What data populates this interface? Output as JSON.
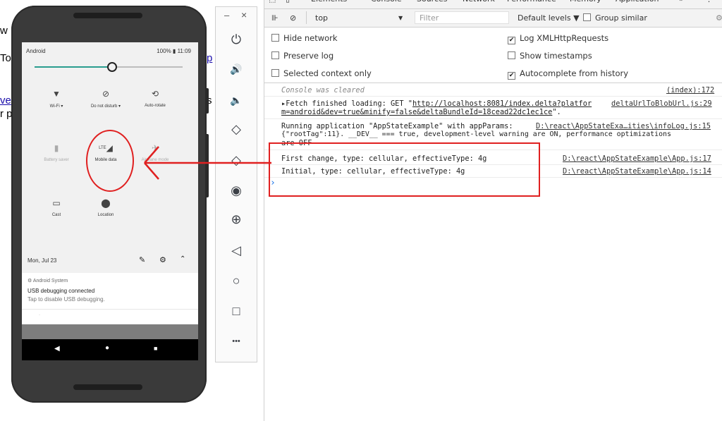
{
  "background_page": {
    "line1": "w",
    "line2": "To",
    "line2_link": "p",
    "line3_link": "ve",
    "line3_tail": "s",
    "line4": "r p"
  },
  "phone": {
    "status_left": "Android",
    "status_right": "100%",
    "status_time": "11:09",
    "tiles": [
      {
        "label": "Wi-Fi ▾",
        "icon": "wifi-off-icon",
        "glyph": "▼",
        "dim": false
      },
      {
        "label": "Do not disturb ▾",
        "icon": "dnd-icon",
        "glyph": "⊘",
        "dim": false
      },
      {
        "label": "Auto-rotate",
        "icon": "auto-rotate-icon",
        "glyph": "⟲",
        "dim": false
      },
      {
        "label": "Battery saver",
        "icon": "battery-icon",
        "glyph": "▮",
        "dim": true
      },
      {
        "label": "Mobile data",
        "icon": "mobile-data-icon",
        "glyph": "◢",
        "badge": "LTE",
        "dim": false
      },
      {
        "label": "Airplane mode",
        "icon": "airplane-icon",
        "glyph": "✈",
        "dim": true
      },
      {
        "label": "Cast",
        "icon": "cast-icon",
        "glyph": "▭",
        "dim": false
      },
      {
        "label": "Location",
        "icon": "location-icon",
        "glyph": "⬤",
        "dim": false
      }
    ],
    "date": "Mon, Jul 23",
    "notification": {
      "app": "Android System",
      "title": "USB debugging connected",
      "body": "Tap to disable USB debugging."
    },
    "nav": {
      "back": "◀",
      "home": "●",
      "recents": "■"
    }
  },
  "emulator": {
    "minimize": "–",
    "close": "×",
    "icons": [
      {
        "name": "power-icon",
        "glyph": "⏻"
      },
      {
        "name": "volume-up-icon",
        "glyph": "🔊"
      },
      {
        "name": "volume-down-icon",
        "glyph": "🔈"
      },
      {
        "name": "rotate-left-icon",
        "glyph": "◇"
      },
      {
        "name": "rotate-right-icon",
        "glyph": "◇"
      },
      {
        "name": "camera-icon",
        "glyph": "◉"
      },
      {
        "name": "zoom-icon",
        "glyph": "⊕"
      },
      {
        "name": "back-icon",
        "glyph": "◁"
      },
      {
        "name": "home-icon",
        "glyph": "○"
      },
      {
        "name": "overview-icon",
        "glyph": "□"
      },
      {
        "name": "more-icon",
        "glyph": "•••"
      }
    ]
  },
  "devtools": {
    "tabs": [
      "Elements",
      "Console",
      "Sources",
      "Network",
      "Performance",
      "Memory",
      "Application",
      "»"
    ],
    "context": "top",
    "filter_placeholder": "Filter",
    "levels": "Default levels ▼",
    "group_similar": "Group similar",
    "options_left": [
      {
        "label": "Hide network",
        "checked": false
      },
      {
        "label": "Preserve log",
        "checked": false
      },
      {
        "label": "Selected context only",
        "checked": false
      }
    ],
    "options_right": [
      {
        "label": "Log XMLHttpRequests",
        "checked": true
      },
      {
        "label": "Show timestamps",
        "checked": false
      },
      {
        "label": "Autocomplete from history",
        "checked": true
      }
    ],
    "console": {
      "cleared": "Console was cleared",
      "cleared_src": "(index):172",
      "fetch_line1_prefix": "▸Fetch finished loading: GET \"",
      "fetch_url1": "http://localhost:8081/index.delta?platfor",
      "fetch_url2": "m=android&dev=true&minify=false&deltaBundleId=18cead22dc1ec1ce",
      "fetch_line2_suffix": "\".",
      "fetch_src": "deltaUrlToBlobUrl.js:29",
      "run_line1": "Running application \"AppStateExample\" with appParams:",
      "run_src": "D:\\react\\AppStateExa…ities\\infoLog.js:15",
      "run_line2": "{\"rootTag\":11}. __DEV__ === true, development-level warning are ON, performance optimizations",
      "run_line3": "are OFF",
      "first_change": "First change, type: cellular, effectiveType: 4g",
      "first_src": "D:\\react\\AppStateExample\\App.js:17",
      "initial": "Initial, type: cellular, effectiveType: 4g",
      "initial_src": "D:\\react\\AppStateExample\\App.js:14",
      "prompt": "›"
    }
  },
  "colors": {
    "annotation": "#e02020",
    "prompt": "#1a73e8",
    "accent": "#2a9d8f"
  }
}
